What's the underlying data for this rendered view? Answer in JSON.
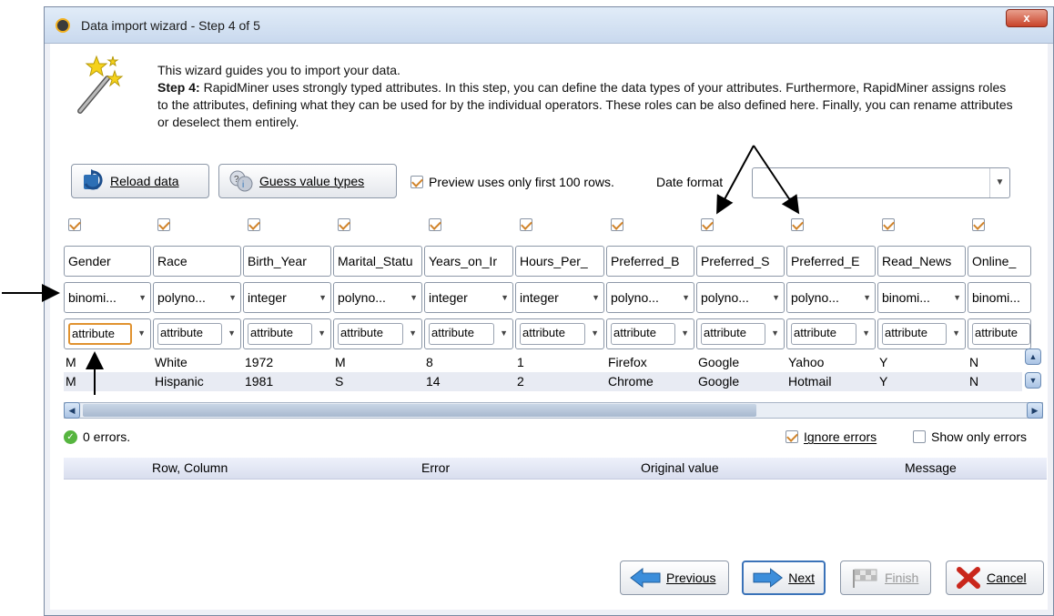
{
  "window": {
    "title": "Data import wizard - Step 4 of 5",
    "close_label": "x"
  },
  "intro": {
    "line1": "This wizard guides you to import your data.",
    "step_label": "Step 4:",
    "step_text": " RapidMiner uses strongly typed attributes. In this step, you can define the data types of your attributes. Furthermore, RapidMiner assigns roles to the attributes, defining what they can be used for by the individual operators. These roles can be also defined here. Finally, you can rename attributes or deselect them entirely."
  },
  "toolbar": {
    "reload_label": "Reload data",
    "guess_label": "Guess value types",
    "preview_label": "Preview uses only first 100 rows.",
    "preview_checked": true,
    "date_format_label": "Date format",
    "date_format_value": ""
  },
  "columns": [
    {
      "name": "Gender",
      "type": "binomi...",
      "role": "attribute"
    },
    {
      "name": "Race",
      "type": "polyno...",
      "role": "attribute"
    },
    {
      "name": "Birth_Year",
      "type": "integer",
      "role": "attribute"
    },
    {
      "name": "Marital_Statu",
      "type": "polyno...",
      "role": "attribute"
    },
    {
      "name": "Years_on_Ir",
      "type": "integer",
      "role": "attribute"
    },
    {
      "name": "Hours_Per_",
      "type": "integer",
      "role": "attribute"
    },
    {
      "name": "Preferred_B",
      "type": "polyno...",
      "role": "attribute"
    },
    {
      "name": "Preferred_S",
      "type": "polyno...",
      "role": "attribute"
    },
    {
      "name": "Preferred_E",
      "type": "polyno...",
      "role": "attribute"
    },
    {
      "name": "Read_News",
      "type": "binomi...",
      "role": "attribute"
    },
    {
      "name": "Online_",
      "type": "binomi...",
      "role": "attribute"
    }
  ],
  "rows": [
    [
      "M",
      "White",
      "1972",
      "M",
      "8",
      "1",
      "Firefox",
      "Google",
      "Yahoo",
      "Y",
      "N"
    ],
    [
      "M",
      "Hispanic",
      "1981",
      "S",
      "14",
      "2",
      "Chrome",
      "Google",
      "Hotmail",
      "Y",
      "N"
    ]
  ],
  "status": {
    "errors_text": "0 errors.",
    "ignore_errors_label": "Ignore errors",
    "ignore_errors_checked": true,
    "show_only_errors_label": "Show only errors",
    "show_only_errors_checked": false
  },
  "error_table": {
    "headers": [
      "Row, Column",
      "Error",
      "Original value",
      "Message"
    ]
  },
  "footer": {
    "previous_label": "Previous",
    "next_label": "Next",
    "finish_label": "Finish",
    "cancel_label": "Cancel"
  }
}
